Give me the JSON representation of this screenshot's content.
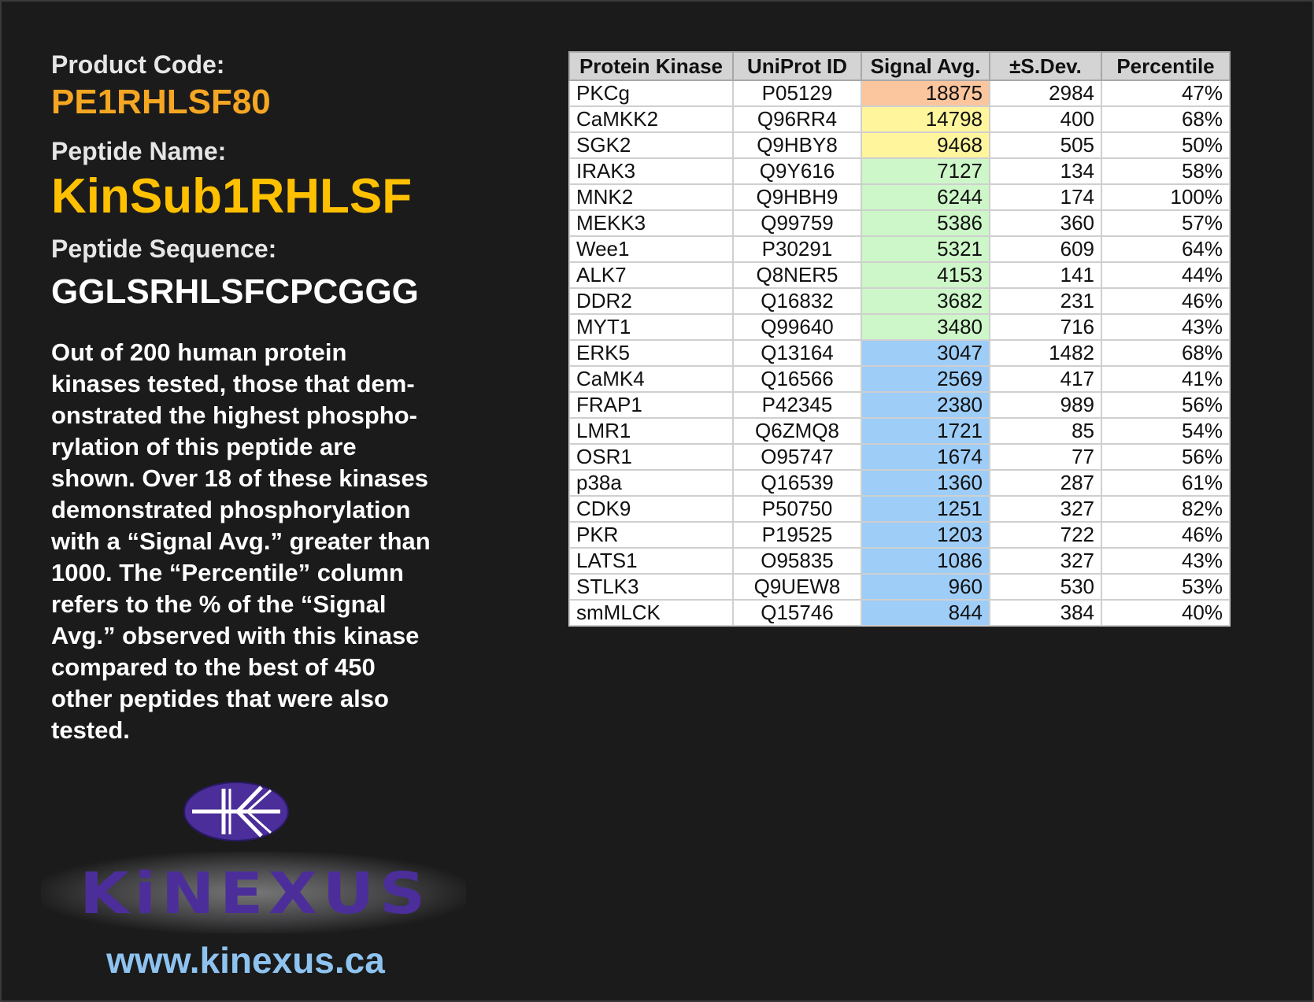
{
  "product": {
    "code_label": "Product Code:",
    "code": "PE1RHLSF80",
    "name_label": "Peptide Name:",
    "name": "KinSub1RHLSF",
    "sequence_label": "Peptide Sequence:",
    "sequence": "GGLSRHLSFCPCGGG",
    "description": "Out of 200 human protein\nkinases tested, those that dem-\nonstrated the highest phospho-\nrylation of this peptide are\nshown. Over 18 of these kinases\ndemonstrated phosphorylation\nwith a “Signal Avg.” greater than\n1000. The “Percentile” column\nrefers to the % of the “Signal\nAvg.” observed with this kinase\ncompared to the best of 450\nother peptides that were also\ntested."
  },
  "logo": {
    "text": "KiNEXUS",
    "url": "www.kinexus.ca",
    "colors": {
      "ellipse": "#4b2e9a",
      "text": "#4b2e9a",
      "url": "#8ec3f0"
    }
  },
  "table": {
    "headers": [
      "Protein Kinase",
      "UniProt ID",
      "Signal Avg.",
      "±S.Dev.",
      "Percentile"
    ],
    "signal_colors": {
      "orange": "#fbc59e",
      "yellow": "#fff59d",
      "green": "#cdf7c8",
      "blue": "#9ecdf8"
    },
    "rows": [
      {
        "kinase": "PKCg",
        "uniprot": "P05129",
        "signal": "18875",
        "sdev": "2984",
        "percentile": "47%",
        "color": "orange"
      },
      {
        "kinase": "CaMKK2",
        "uniprot": "Q96RR4",
        "signal": "14798",
        "sdev": "400",
        "percentile": "68%",
        "color": "yellow"
      },
      {
        "kinase": "SGK2",
        "uniprot": "Q9HBY8",
        "signal": "9468",
        "sdev": "505",
        "percentile": "50%",
        "color": "yellow"
      },
      {
        "kinase": "IRAK3",
        "uniprot": "Q9Y616",
        "signal": "7127",
        "sdev": "134",
        "percentile": "58%",
        "color": "green"
      },
      {
        "kinase": "MNK2",
        "uniprot": "Q9HBH9",
        "signal": "6244",
        "sdev": "174",
        "percentile": "100%",
        "color": "green"
      },
      {
        "kinase": "MEKK3",
        "uniprot": "Q99759",
        "signal": "5386",
        "sdev": "360",
        "percentile": "57%",
        "color": "green"
      },
      {
        "kinase": "Wee1",
        "uniprot": "P30291",
        "signal": "5321",
        "sdev": "609",
        "percentile": "64%",
        "color": "green"
      },
      {
        "kinase": "ALK7",
        "uniprot": "Q8NER5",
        "signal": "4153",
        "sdev": "141",
        "percentile": "44%",
        "color": "green"
      },
      {
        "kinase": "DDR2",
        "uniprot": "Q16832",
        "signal": "3682",
        "sdev": "231",
        "percentile": "46%",
        "color": "green"
      },
      {
        "kinase": "MYT1",
        "uniprot": "Q99640",
        "signal": "3480",
        "sdev": "716",
        "percentile": "43%",
        "color": "green"
      },
      {
        "kinase": "ERK5",
        "uniprot": "Q13164",
        "signal": "3047",
        "sdev": "1482",
        "percentile": "68%",
        "color": "blue"
      },
      {
        "kinase": "CaMK4",
        "uniprot": "Q16566",
        "signal": "2569",
        "sdev": "417",
        "percentile": "41%",
        "color": "blue"
      },
      {
        "kinase": "FRAP1",
        "uniprot": "P42345",
        "signal": "2380",
        "sdev": "989",
        "percentile": "56%",
        "color": "blue"
      },
      {
        "kinase": "LMR1",
        "uniprot": "Q6ZMQ8",
        "signal": "1721",
        "sdev": "85",
        "percentile": "54%",
        "color": "blue"
      },
      {
        "kinase": "OSR1",
        "uniprot": "O95747",
        "signal": "1674",
        "sdev": "77",
        "percentile": "56%",
        "color": "blue"
      },
      {
        "kinase": "p38a",
        "uniprot": "Q16539",
        "signal": "1360",
        "sdev": "287",
        "percentile": "61%",
        "color": "blue"
      },
      {
        "kinase": "CDK9",
        "uniprot": "P50750",
        "signal": "1251",
        "sdev": "327",
        "percentile": "82%",
        "color": "blue"
      },
      {
        "kinase": "PKR",
        "uniprot": "P19525",
        "signal": "1203",
        "sdev": "722",
        "percentile": "46%",
        "color": "blue"
      },
      {
        "kinase": "LATS1",
        "uniprot": "O95835",
        "signal": "1086",
        "sdev": "327",
        "percentile": "43%",
        "color": "blue"
      },
      {
        "kinase": "STLK3",
        "uniprot": "Q9UEW8",
        "signal": "960",
        "sdev": "530",
        "percentile": "53%",
        "color": "blue"
      },
      {
        "kinase": "smMLCK",
        "uniprot": "Q15746",
        "signal": "844",
        "sdev": "384",
        "percentile": "40%",
        "color": "blue"
      }
    ]
  }
}
